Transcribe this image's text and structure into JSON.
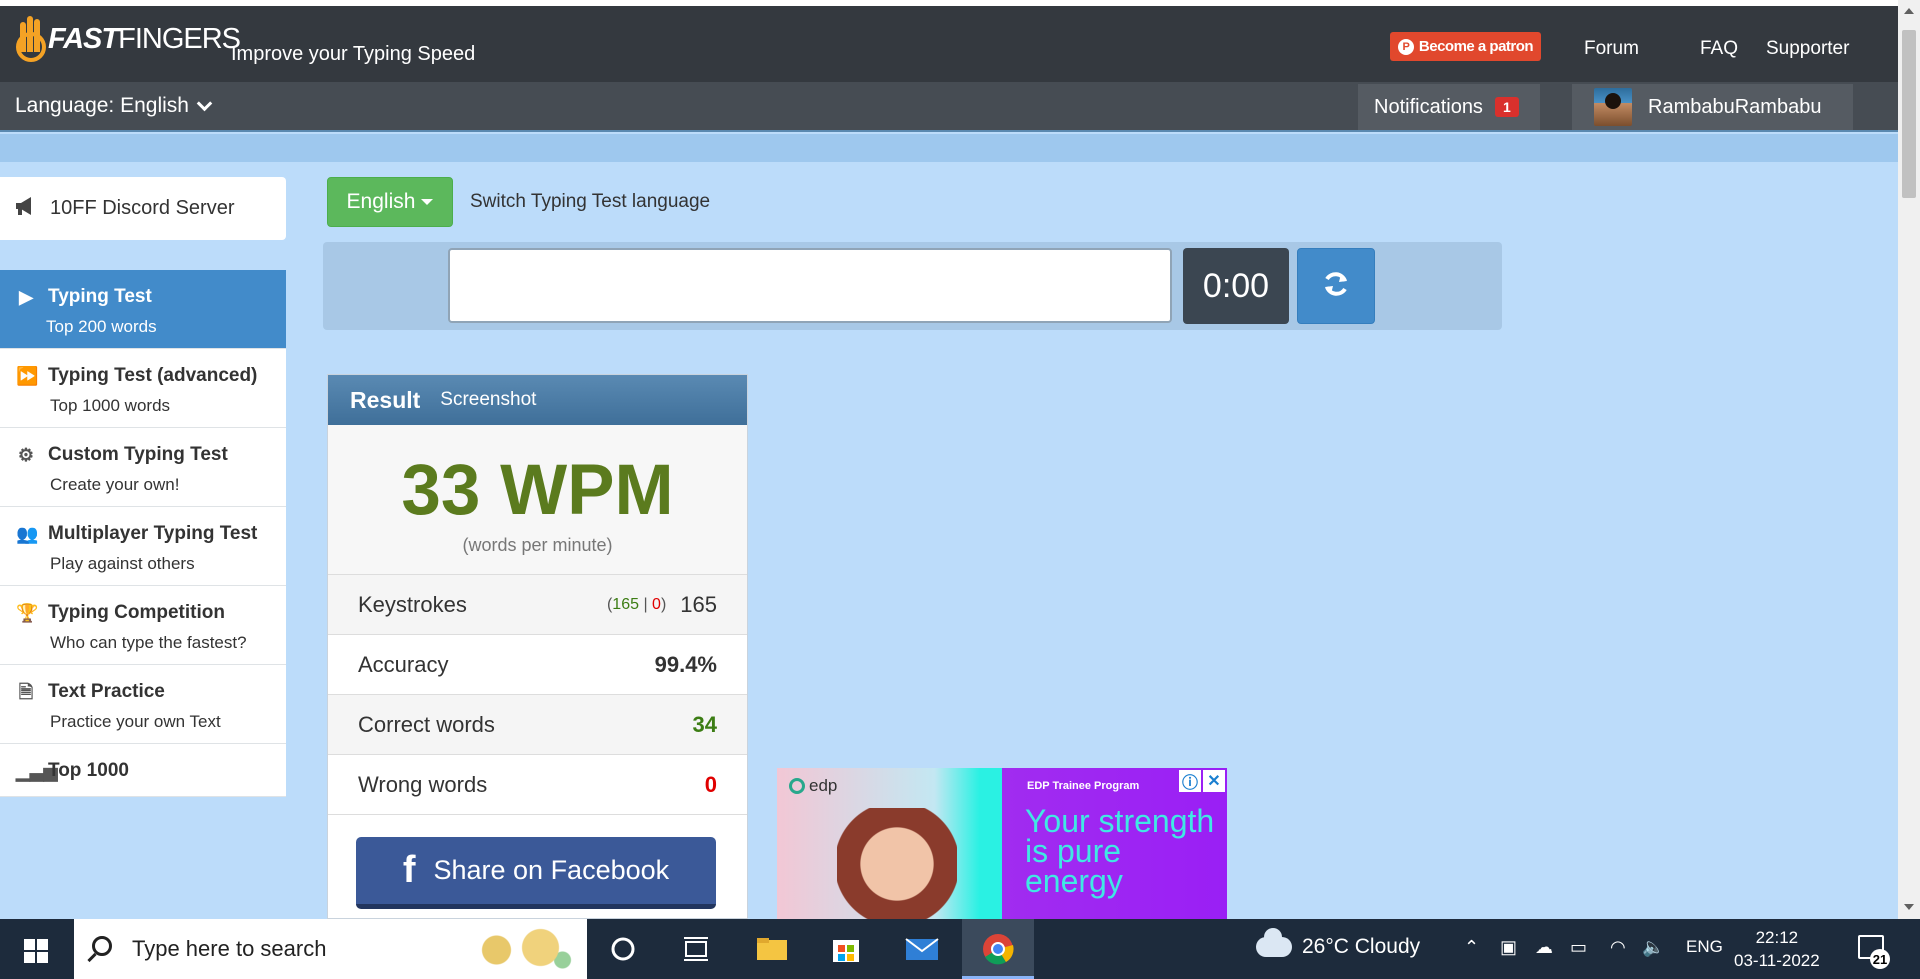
{
  "header": {
    "logo_text_bold": "FAST",
    "logo_text_rest": "FINGERS",
    "tagline": "Improve your Typing Speed",
    "patron_label": "Become a patron",
    "nav": [
      "Forum",
      "FAQ",
      "Supporter"
    ],
    "language_label": "Language: English",
    "notifications_label": "Notifications",
    "notifications_count": "1",
    "username": "RambabuRambabu"
  },
  "sidebar": {
    "discord": "10FF Discord Server",
    "items": [
      {
        "title": "Typing Test",
        "sub": "Top 200 words",
        "icon": "play-icon",
        "active": true
      },
      {
        "title": "Typing Test (advanced)",
        "sub": "Top 1000 words",
        "icon": "fast-forward-icon"
      },
      {
        "title": "Custom Typing Test",
        "sub": "Create your own!",
        "icon": "cogs-icon"
      },
      {
        "title": "Multiplayer Typing Test",
        "sub": "Play against others",
        "icon": "users-icon"
      },
      {
        "title": "Typing Competition",
        "sub": "Who can type the fastest?",
        "icon": "trophy-icon"
      },
      {
        "title": "Text Practice",
        "sub": "Practice your own Text",
        "icon": "document-icon"
      },
      {
        "title": "Top 1000",
        "sub": "",
        "icon": "signal-icon"
      }
    ]
  },
  "test": {
    "language_button": "English",
    "switch_label": "Switch Typing Test language",
    "input_value": "",
    "timer": "0:00"
  },
  "result": {
    "title": "Result",
    "screenshot_label": "Screenshot",
    "wpm": "33 WPM",
    "wpm_sub": "(words per minute)",
    "keystrokes_label": "Keystrokes",
    "keystrokes_correct": "165",
    "keystrokes_wrong": "0",
    "keystrokes_total": "165",
    "accuracy_label": "Accuracy",
    "accuracy_value": "99.4%",
    "correct_label": "Correct words",
    "correct_value": "34",
    "wrong_label": "Wrong words",
    "wrong_value": "0",
    "share_label": "Share on Facebook"
  },
  "ad": {
    "brand": "edp",
    "program": "EDP Trainee Program",
    "headline": "Your strength is pure energy"
  },
  "taskbar": {
    "search_placeholder": "Type here to search",
    "weather": "26°C  Cloudy",
    "language": "ENG",
    "time": "22:12",
    "date": "03-11-2022",
    "notification_count": "21"
  },
  "colors": {
    "accent_blue": "#428bca",
    "success_green": "#5cb85c",
    "wpm_green": "#5b7b1e",
    "error_red": "#e00000",
    "patron_orange": "#e1482d"
  }
}
